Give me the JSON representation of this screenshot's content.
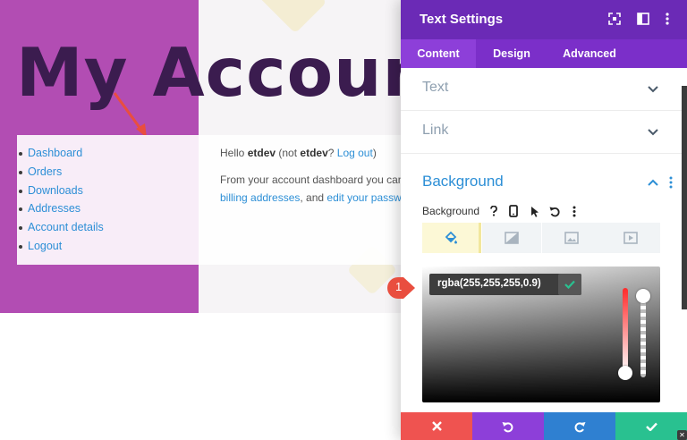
{
  "page": {
    "title": "My Accoun",
    "nav_items": [
      "Dashboard",
      "Orders",
      "Downloads",
      "Addresses",
      "Account details",
      "Logout"
    ],
    "hello": {
      "prefix": "Hello ",
      "user": "etdev",
      "mid": " (not ",
      "user2": "etdev",
      "q": "? ",
      "logout_link": "Log out",
      "suffix": ")"
    },
    "dashboard_text": "From your account dashboard you can",
    "billing_link": "billing addresses",
    "and_text": ", and ",
    "password_link": "edit your passwo"
  },
  "panel": {
    "title": "Text Settings",
    "tabs": [
      "Content",
      "Design",
      "Advanced"
    ],
    "active_tab": "Content",
    "toggles": [
      "Text",
      "Link"
    ],
    "background": {
      "section_title": "Background",
      "label": "Background",
      "color_value": "rgba(255,255,255,0.9)",
      "type_tabs": [
        "color",
        "gradient",
        "image",
        "video"
      ],
      "hue_level": 0.9,
      "alpha_level": 0.9
    },
    "footer": [
      "discard",
      "undo",
      "redo",
      "save"
    ]
  },
  "annotation": {
    "badge": "1"
  },
  "colors": {
    "purple_page": "#b24db3",
    "panel_header": "#6b2ab6",
    "tab_bar": "#7b2fc9",
    "accent_blue": "#2d8fd6",
    "footer_red": "#ef5350",
    "footer_purple": "#8d3fd9",
    "footer_blue": "#2f80d1",
    "footer_green": "#29c190",
    "annotation_red": "#e94e3f"
  }
}
